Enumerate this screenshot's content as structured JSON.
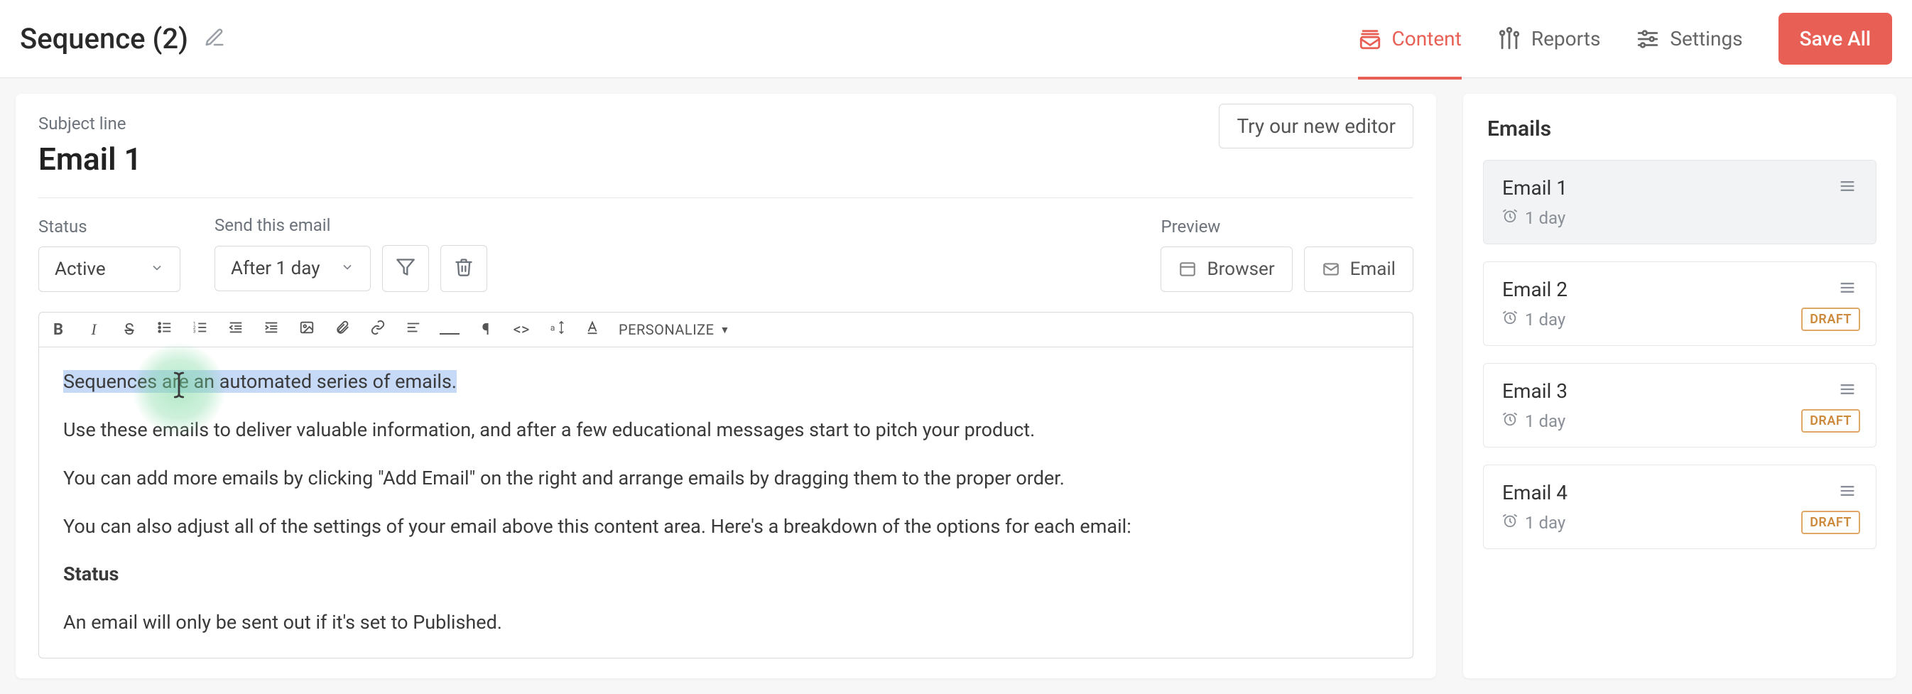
{
  "header": {
    "title": "Sequence (2)",
    "nav": {
      "content": "Content",
      "reports": "Reports",
      "settings": "Settings"
    },
    "save_all": "Save All"
  },
  "main": {
    "try_editor": "Try our new editor",
    "subject_label": "Subject line",
    "email_title": "Email 1",
    "status_label": "Status",
    "status_value": "Active",
    "send_label": "Send this email",
    "send_value": "After 1 day",
    "preview_label": "Preview",
    "preview_browser": "Browser",
    "preview_email": "Email",
    "toolbar": {
      "personalize": "PERSONALIZE"
    },
    "body": {
      "p1": "Sequences are an automated series of emails.",
      "p2": "Use these emails to deliver valuable information, and after a few educational messages start to pitch your product.",
      "p3": "You can add more emails by clicking \"Add Email\" on the right and arrange emails by dragging them to the proper order.",
      "p4": "You can also adjust all of the settings of your email above this content area. Here's a breakdown of the options for each email:",
      "h_status": "Status",
      "p5": "An email will only be sent out if it's set to Published."
    }
  },
  "side": {
    "title": "Emails",
    "emails": [
      {
        "name": "Email 1",
        "delay": "1 day",
        "draft": false,
        "active": true
      },
      {
        "name": "Email 2",
        "delay": "1 day",
        "draft": true,
        "active": false
      },
      {
        "name": "Email 3",
        "delay": "1 day",
        "draft": true,
        "active": false
      },
      {
        "name": "Email 4",
        "delay": "1 day",
        "draft": true,
        "active": false
      }
    ],
    "draft_label": "DRAFT"
  }
}
